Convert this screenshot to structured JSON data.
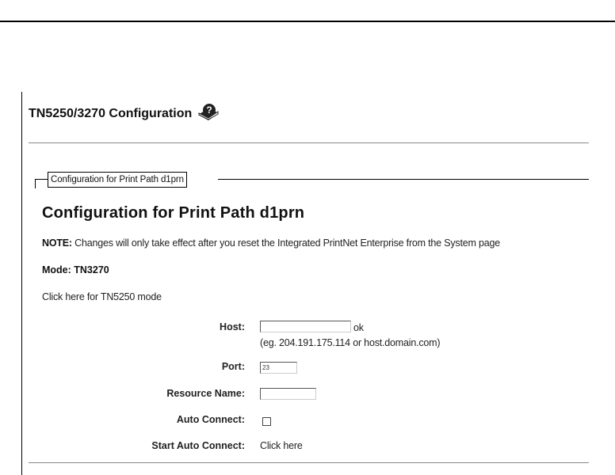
{
  "page": {
    "title": "TN5250/3270 Configuration",
    "help_icon": "help-book-icon"
  },
  "panel": {
    "legend": "Configuration for Print Path d1prn",
    "heading": "Configuration for Print Path d1prn",
    "note_label": "NOTE:",
    "note_text": " Changes will only take effect after you reset the Integrated PrintNet Enterprise from the System page",
    "mode": "Mode: TN3270",
    "switch_link": "Click here for TN5250 mode"
  },
  "form": {
    "host_label": "Host:",
    "host_value": "",
    "host_status": "ok",
    "host_hint": "(eg. 204.191.175.114 or host.domain.com)",
    "port_label": "Port:",
    "port_value": "23",
    "resource_label": "Resource Name:",
    "resource_value": "",
    "auto_connect_label": "Auto Connect:",
    "auto_connect_checked": false,
    "start_auto_label": "Start Auto Connect:",
    "start_auto_link": "Click here"
  }
}
